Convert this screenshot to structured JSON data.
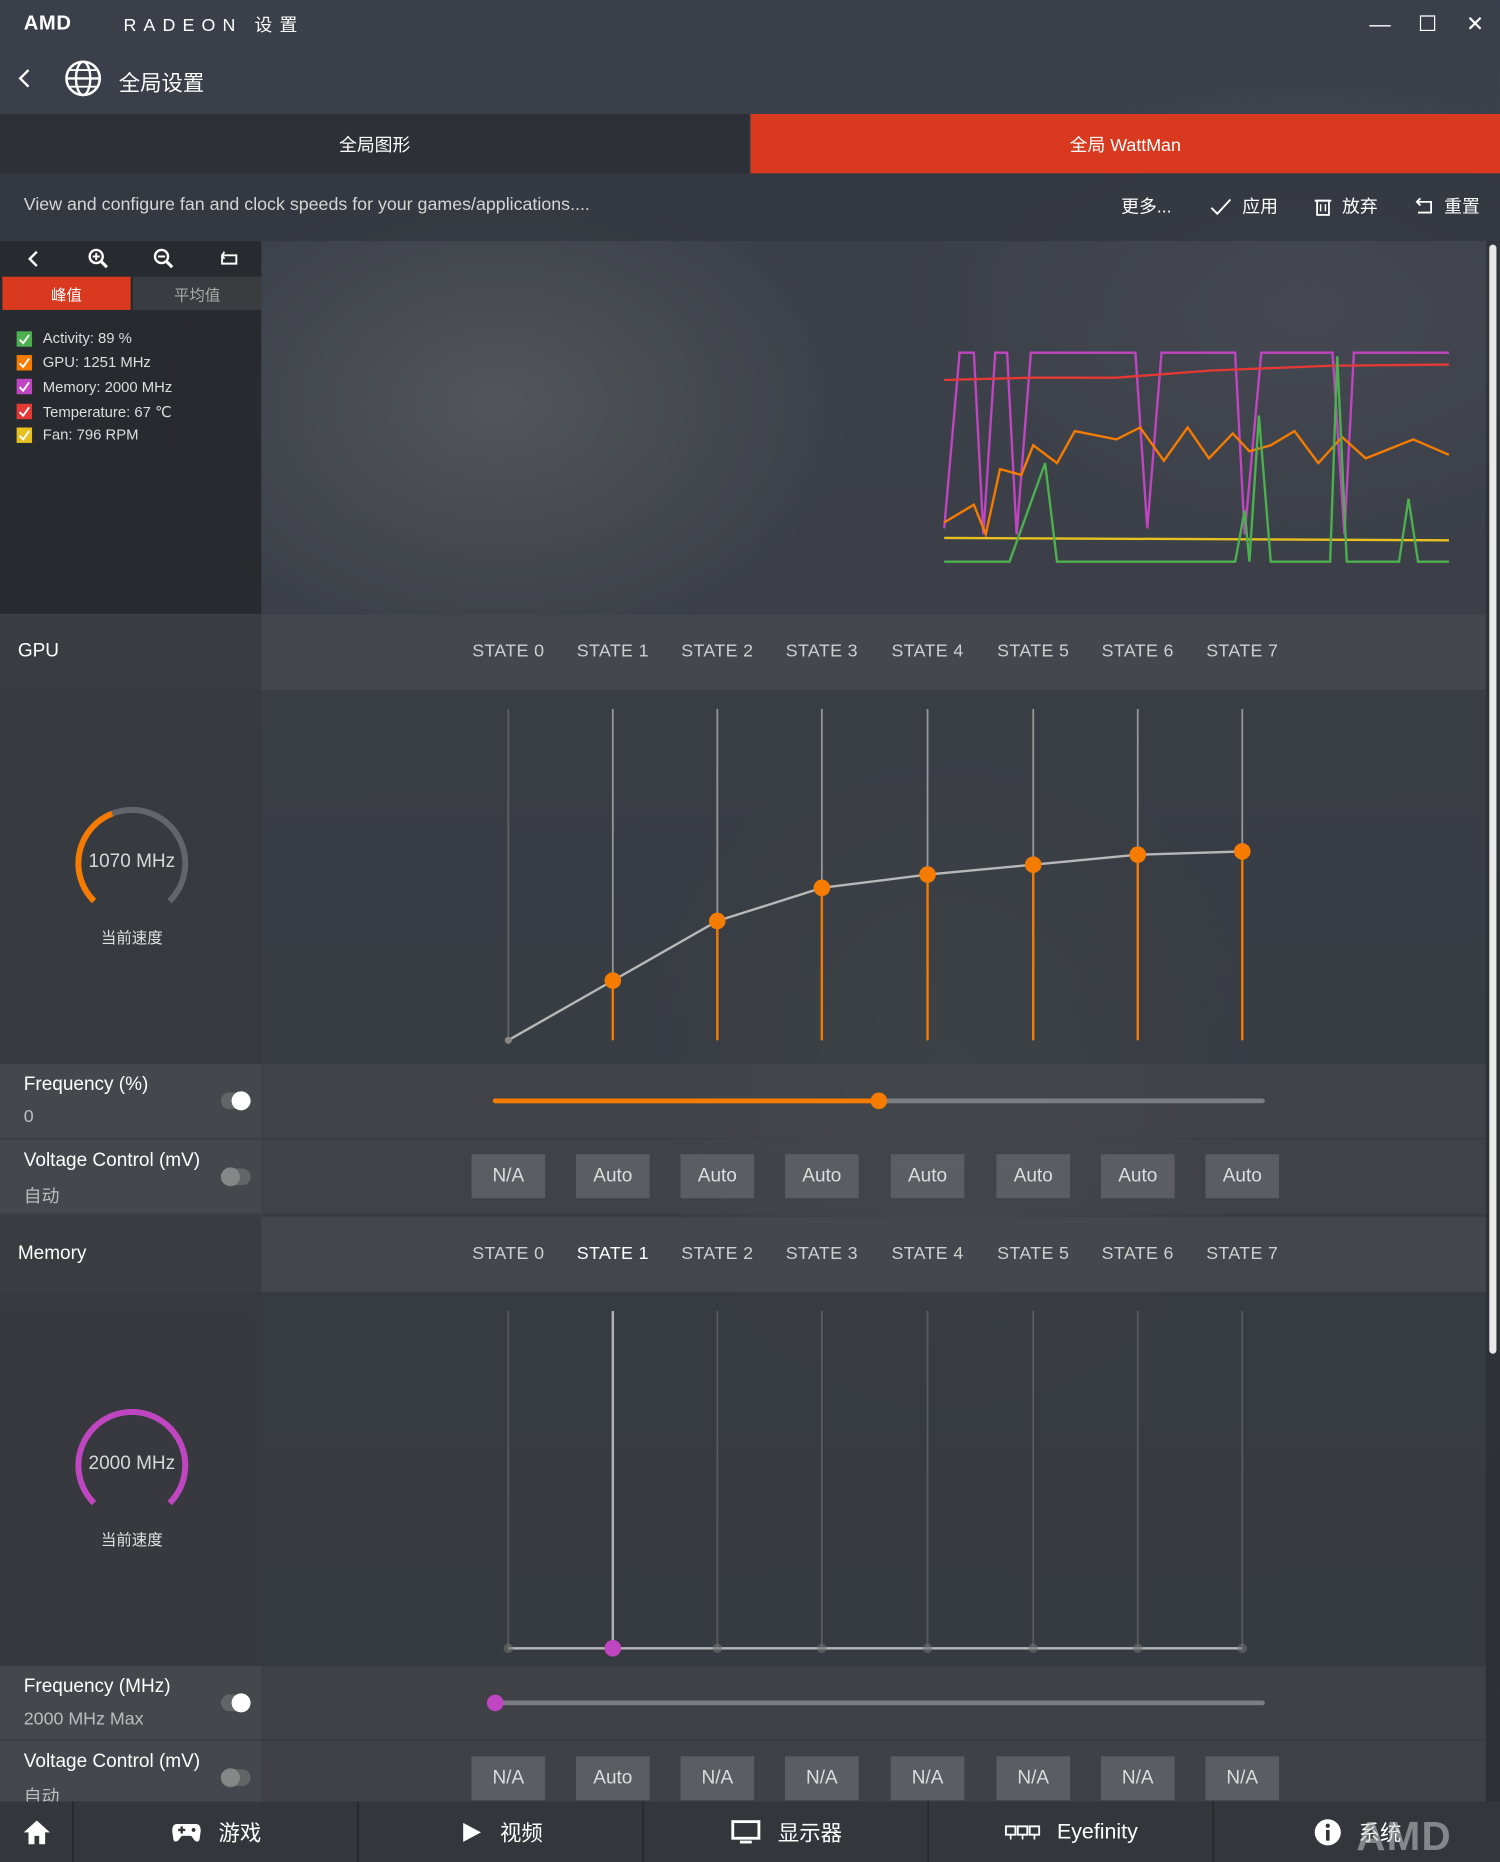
{
  "app": {
    "logo": "AMD",
    "brand": "RADEON 设置"
  },
  "window": {
    "minimize": "—",
    "maximize": "☐",
    "close": "✕"
  },
  "header": {
    "title": "全局设置"
  },
  "tabs": [
    {
      "label": "全局图形"
    },
    {
      "label": "全局 WattMan"
    }
  ],
  "toolbar": {
    "description": "View and configure fan and clock speeds for your games/applications....",
    "more": "更多...",
    "apply": "应用",
    "discard": "放弃",
    "reset": "重置"
  },
  "monitor": {
    "peak_tab": "峰值",
    "average_tab": "平均值",
    "legend": [
      {
        "label": "Activity: 89 %",
        "color": "#4caf50"
      },
      {
        "label": "GPU: 1251 MHz",
        "color": "#f57c00"
      },
      {
        "label": "Memory: 2000 MHz",
        "color": "#c045c0"
      },
      {
        "label": "Temperature: 67 ℃",
        "color": "#e53935"
      },
      {
        "label": "Fan: 796 RPM",
        "color": "#e8c020"
      }
    ]
  },
  "gpu": {
    "section_title": "GPU",
    "states": [
      "STATE 0",
      "STATE 1",
      "STATE 2",
      "STATE 3",
      "STATE 4",
      "STATE 5",
      "STATE 6",
      "STATE 7"
    ],
    "gauge_value": "1070 MHz",
    "gauge_fraction": 0.42,
    "gauge_label": "当前速度",
    "frequency_title": "Frequency (%)",
    "frequency_value": "0",
    "frequency_slider": 0.5,
    "voltage_title": "Voltage Control (mV)",
    "voltage_value": "自动",
    "voltage_buttons": [
      "N/A",
      "Auto",
      "Auto",
      "Auto",
      "Auto",
      "Auto",
      "Auto",
      "Auto"
    ],
    "state_levels": [
      0.0,
      0.18,
      0.36,
      0.46,
      0.5,
      0.53,
      0.56,
      0.57
    ]
  },
  "memory": {
    "section_title": "Memory",
    "states": [
      "STATE 0",
      "STATE 1",
      "STATE 2",
      "STATE 3",
      "STATE 4",
      "STATE 5",
      "STATE 6",
      "STATE 7"
    ],
    "gauge_value": "2000 MHz",
    "gauge_fraction": 1.0,
    "gauge_label": "当前速度",
    "frequency_title": "Frequency (MHz)",
    "frequency_value": "2000 MHz Max",
    "frequency_slider": 0.0,
    "voltage_title": "Voltage Control (mV)",
    "voltage_value": "自动",
    "voltage_buttons": [
      "N/A",
      "Auto",
      "N/A",
      "N/A",
      "N/A",
      "N/A",
      "N/A",
      "N/A"
    ]
  },
  "nav": [
    {
      "label": ""
    },
    {
      "label": "游戏"
    },
    {
      "label": "视频"
    },
    {
      "label": "显示器"
    },
    {
      "label": "Eyefinity"
    },
    {
      "label": "系统"
    }
  ],
  "watermark": "AMD"
}
